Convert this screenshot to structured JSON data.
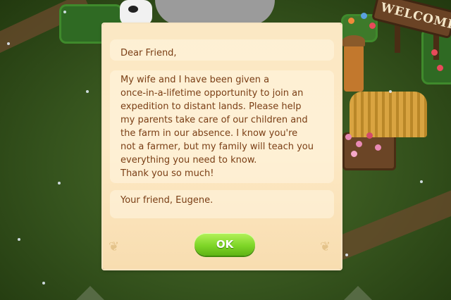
{
  "background": {
    "sign_text": "WELCOME",
    "colors": {
      "grass": "#3f5f22",
      "path": "#6b4a2c",
      "hedge": "#2f6a23"
    }
  },
  "letter": {
    "greeting": "Dear Friend,",
    "body_lines": [
      "My wife and I have been given a",
      "once-in-a-lifetime opportunity to join an",
      "expedition to distant lands. Please help",
      "my parents take care of our children and",
      "the farm in our absence. I know you're",
      "not a farmer, but my family will teach you",
      "everything you need to know.",
      "Thank you so much!"
    ],
    "signoff": "Your friend, Eugene.",
    "ok_label": "OK",
    "colors": {
      "paper": "#fde9c5",
      "text": "#7a3e15",
      "button": "#7fd628"
    }
  }
}
